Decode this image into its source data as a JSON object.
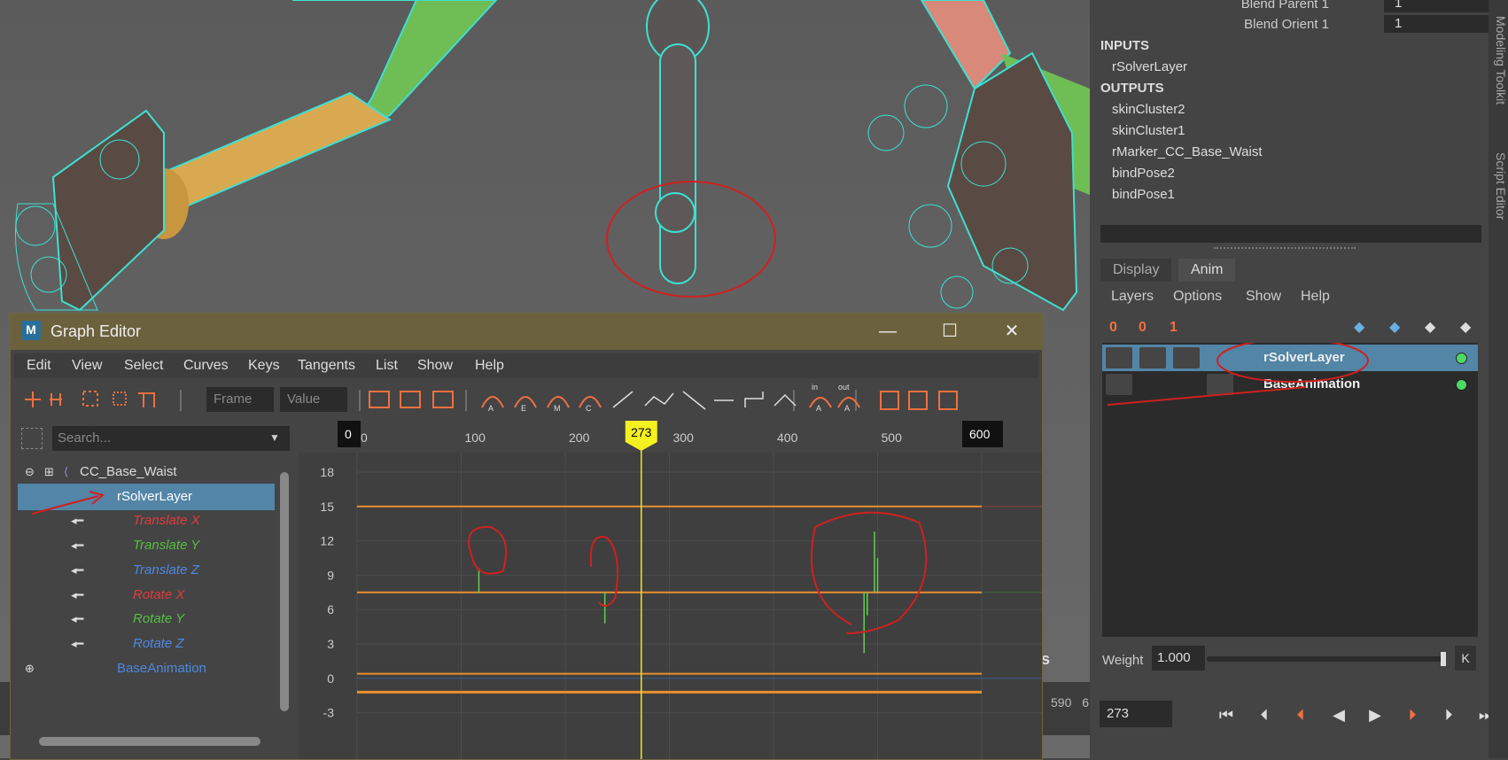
{
  "attributes": [
    {
      "label": "Blend Parent 1",
      "value": "1"
    },
    {
      "label": "Blend Orient 1",
      "value": "1"
    }
  ],
  "inputs": {
    "header": "INPUTS",
    "items": [
      "rSolverLayer"
    ]
  },
  "outputs": {
    "header": "OUTPUTS",
    "items": [
      "skinCluster2",
      "skinCluster1",
      "rMarker_CC_Base_Waist",
      "bindPose2",
      "bindPose1"
    ]
  },
  "side_tabs": [
    "Modeling Toolkit",
    "Script Editor"
  ],
  "layer_editor": {
    "tabs": [
      "Display",
      "Anim"
    ],
    "menu": [
      "Layers",
      "Options",
      "Show",
      "Help"
    ],
    "tool_labels": [
      "0",
      "0",
      "1"
    ],
    "layers": [
      {
        "name": "rSolverLayer",
        "selected": true
      },
      {
        "name": "BaseAnimation",
        "selected": false
      }
    ],
    "weight_label": "Weight",
    "weight_value": "1.000",
    "weight_fraction": 1.0,
    "key_label": "K"
  },
  "transport": {
    "current_frame": "273"
  },
  "timeline": {
    "tick_label": "590",
    "partial": "6",
    "viewport_hud": "s"
  },
  "graph_editor": {
    "title": "Graph Editor",
    "logo": "M",
    "window_controls": {
      "minimize": "—",
      "maximize": "☐",
      "close": "✕"
    },
    "menu": [
      "Edit",
      "View",
      "Select",
      "Curves",
      "Keys",
      "Tangents",
      "List",
      "Show",
      "Help"
    ],
    "frame_placeholder": "Frame",
    "value_placeholder": "Value",
    "tool_letters": [
      "A",
      "E",
      "M",
      "C",
      "A",
      "A"
    ],
    "tool_tags": [
      "in",
      "out"
    ],
    "search_placeholder": "Search...",
    "outliner": [
      {
        "label": "CC_Base_Waist",
        "color": "#dddddd",
        "icon": "joint-icon"
      },
      {
        "label": "rSolverLayer",
        "color": "#ffffff",
        "selected": true
      },
      {
        "label": "Translate X",
        "color": "#e03c3c",
        "italic": true
      },
      {
        "label": "Translate Y",
        "color": "#55c040",
        "italic": true
      },
      {
        "label": "Translate Z",
        "color": "#4f88e0",
        "italic": true
      },
      {
        "label": "Rotate X",
        "color": "#e03c3c",
        "italic": true
      },
      {
        "label": "Rotate Y",
        "color": "#55c040",
        "italic": true
      },
      {
        "label": "Rotate Z",
        "color": "#4f88e0",
        "italic": true
      },
      {
        "label": "BaseAnimation",
        "color": "#4f88e0"
      }
    ],
    "time_range": {
      "start": 0,
      "end": 600
    },
    "current_time": 273,
    "x_ticks": [
      0,
      100,
      200,
      300,
      400,
      500
    ],
    "y_ticks": [
      18,
      15,
      12,
      9,
      6,
      3,
      0,
      -3
    ],
    "start_label": "0",
    "end_label": "600",
    "current_label": "273"
  }
}
